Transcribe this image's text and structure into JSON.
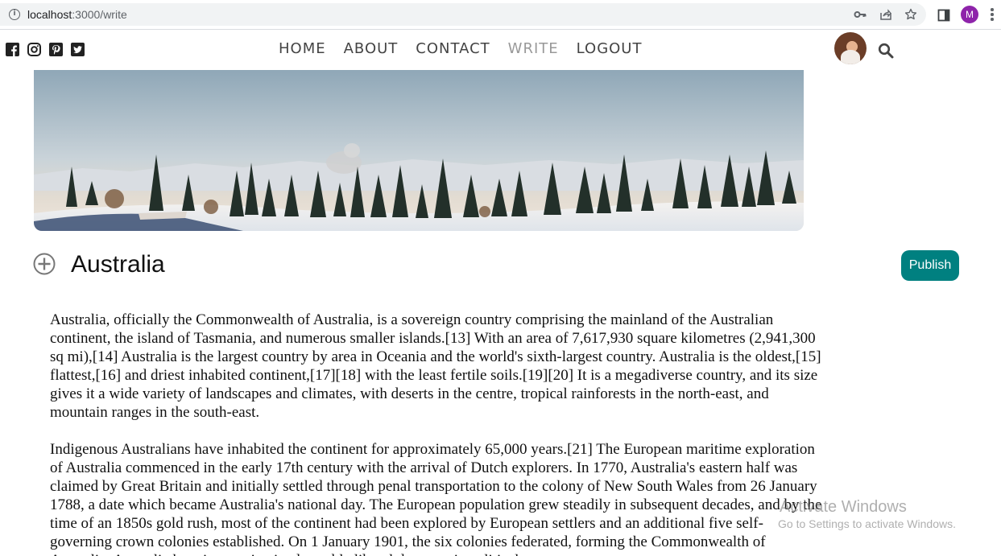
{
  "browser": {
    "url_host": "localhost",
    "url_path": ":3000/write",
    "profile_initial": "M"
  },
  "topbar": {
    "social_icons": [
      "facebook-square-icon",
      "instagram-icon",
      "pinterest-icon",
      "twitter-square-icon"
    ],
    "nav": [
      "HOME",
      "ABOUT",
      "CONTACT",
      "WRITE",
      "LOGOUT"
    ],
    "active_nav": "WRITE"
  },
  "write": {
    "title": "Australia",
    "publish_label": "Publish",
    "paragraphs": [
      "Australia, officially the Commonwealth of Australia, is a sovereign country comprising the mainland of the Australian continent, the island of Tasmania, and numerous smaller islands.[13] With an area of 7,617,930 square kilometres (2,941,300 sq mi),[14] Australia is the largest country by area in Oceania and the world's sixth-largest country. Australia is the oldest,[15] flattest,[16] and driest inhabited continent,[17][18] with the least fertile soils.[19][20] It is a megadiverse country, and its size gives it a wide variety of landscapes and climates, with deserts in the centre, tropical rainforests in the north-east, and mountain ranges in the south-east.",
      "Indigenous Australians have inhabited the continent for approximately 65,000 years.[21] The European maritime exploration of Australia commenced in the early 17th century with the arrival of Dutch explorers. In 1770, Australia's eastern half was claimed by Great Britain and initially settled through penal transportation to the colony of New South Wales from 26 January 1788, a date which became Australia's national day. The European population grew steadily in subsequent decades, and by the time of an 1850s gold rush, most of the continent had been explored by European settlers and an additional five self-governing crown colonies established. On 1 January 1901, the six colonies federated, forming the Commonwealth of Australia. Australia has since maintained a stable liberal democratic political"
    ]
  },
  "watermark": {
    "title": "Activate Windows",
    "subtitle": "Go to Settings to activate Windows."
  },
  "colors": {
    "publish_bg": "#008080",
    "nav_text": "#444444",
    "nav_active": "#999999"
  }
}
